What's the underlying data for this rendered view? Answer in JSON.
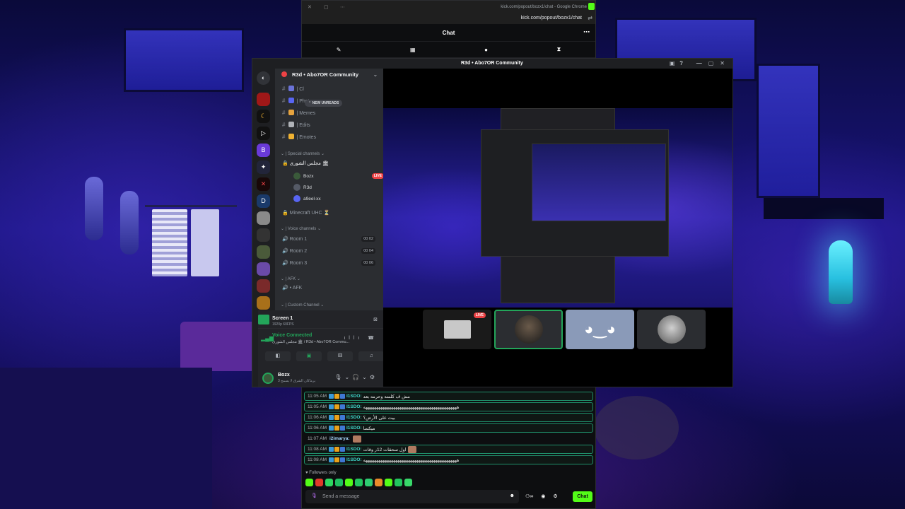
{
  "chrome": {
    "title": "kick.com/popout/bozx1/chat - Google Chrome",
    "url": "kick.com/popout/bozx1/chat",
    "controls": [
      "✕",
      "▢",
      "⋯"
    ]
  },
  "kick_chat": {
    "header": "Chat",
    "more_icon": "⋯",
    "tools": [
      "✎",
      "▦",
      "●",
      "⧗"
    ],
    "messages": [
      {
        "time": "11:05 AM",
        "user": "I1SDO:",
        "text": "مش ف كلمته وحرمه بعد",
        "highlight": true,
        "emote": false
      },
      {
        "time": "11:05 AM",
        "user": "I1SDO:",
        "text": "ههههههههههههههههههههههههههههههههههههههههههههه",
        "highlight": true,
        "emote": false
      },
      {
        "time": "11:06 AM",
        "user": "I1SDO:",
        "text": "بيت على الأرض؟",
        "highlight": true,
        "emote": false
      },
      {
        "time": "11:06 AM",
        "user": "I1SDO:",
        "text": "ميكسا",
        "highlight": true,
        "emote": false
      },
      {
        "time": "11:07 AM",
        "user": "i2imarya:",
        "text": "",
        "highlight": false,
        "emote": true
      },
      {
        "time": "11:08 AM",
        "user": "I1SDO:",
        "text": "اول سحقات 12ر وقات",
        "highlight": true,
        "emote": true
      },
      {
        "time": "11:08 AM",
        "user": "I1SDO:",
        "text": "ههههههههههههههههههههههههههههههههههههههههههههه",
        "highlight": true,
        "emote": false
      }
    ],
    "followers_only": "♥ Followers only",
    "emote_colors": [
      "#53fc18",
      "#e03a2a",
      "#2ed860",
      "#1fbf60",
      "#53fc18",
      "#22c55e",
      "#2ecc71",
      "#e88a2a",
      "#53fc18",
      "#22c55e",
      "#38d86a"
    ],
    "input_placeholder": "Send a message",
    "send_label": "Chat",
    "actions": [
      "⚇∞",
      "◉",
      "⚙"
    ]
  },
  "discord": {
    "title": "R3d • Abo7OR Community",
    "title_icons": [
      "▣",
      "?"
    ],
    "window_controls": [
      "—",
      "▢",
      "✕"
    ],
    "server_name": "R3d • Abo7OR Community",
    "new_unreads": "NEW UNREADS",
    "text_channels": [
      {
        "name": "Cl",
        "color": "#6b73d8"
      },
      {
        "name": "Photos",
        "color": "#5865f2"
      },
      {
        "name": "Memes",
        "color": "#e6a33e"
      },
      {
        "name": "Edits",
        "color": "#b0b3b8"
      },
      {
        "name": "Emotes",
        "color": "#f0b232"
      }
    ],
    "special_category": "Special channels",
    "special_channel": "مجلس الشورى 🏛",
    "voice_users": [
      {
        "name": "Bozx",
        "live": "LIVE",
        "color": "#3a5a3a"
      },
      {
        "name": "R3d",
        "color": "#555a66"
      },
      {
        "name": "a9eel-xx",
        "color": "#5865f2"
      }
    ],
    "minecraft_channel": "Minecraft UHC ⏳",
    "voice_category": "Voice channels",
    "rooms": [
      {
        "name": "Room 1",
        "limit": "00  02"
      },
      {
        "name": "Room 2",
        "limit": "00  04"
      },
      {
        "name": "Room 3",
        "limit": "00  06"
      }
    ],
    "afk_category": "AFK",
    "afk_channel": "AFK",
    "custom_category": "Custom Channel",
    "screen_share": {
      "name": "Screen 1",
      "sub": "1920p 60FPS"
    },
    "voice_connected": "Voice Connected",
    "voice_where": "مجلس الشورى 🏛 / R3d • Abo7OR Commu...",
    "user": {
      "name": "Bozx",
      "status": "يرماكان الشرق لا يسمح 3"
    },
    "stage_tiles": [
      "LIVE"
    ]
  }
}
